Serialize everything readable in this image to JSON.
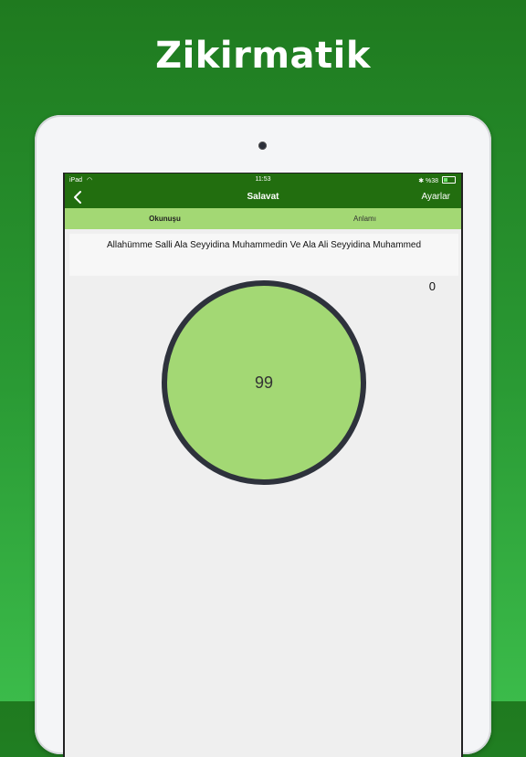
{
  "promo": {
    "title": "Zikirmatik"
  },
  "statusbar": {
    "device": "iPad",
    "time": "11:53",
    "battery": "%38"
  },
  "navbar": {
    "title": "Salavat",
    "right_label": "Ayarlar",
    "back_icon": "chevron-left-icon"
  },
  "tabs": [
    {
      "label": "Okunuşu",
      "active": true
    },
    {
      "label": "Anlamı",
      "active": false
    }
  ],
  "prayer": {
    "text": "Allahümme Salli Ala Seyyidina Muhammedin Ve Ala Ali Seyyidina Muhammed"
  },
  "counter": {
    "count": "0",
    "target": "99"
  },
  "colors": {
    "primary": "#226e0f",
    "accent": "#a3d874",
    "ring": "#2e323c"
  }
}
